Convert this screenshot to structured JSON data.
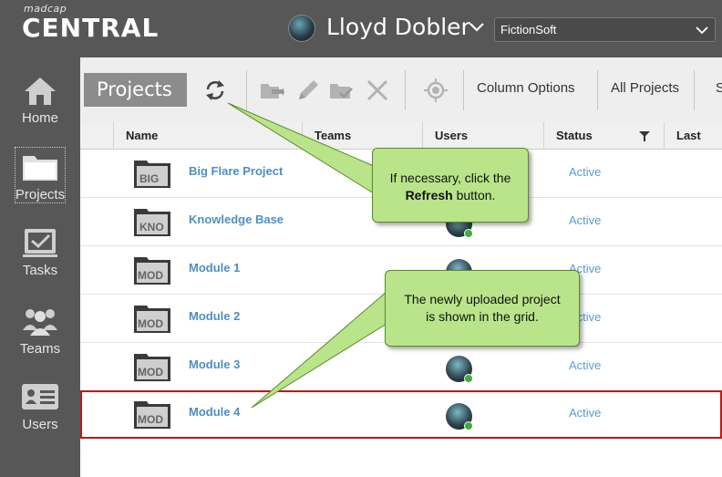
{
  "header": {
    "brand_small": "madcap",
    "brand_big": "CENTRAL",
    "user_name": "Lloyd Dobler",
    "org_selected": "FictionSoft"
  },
  "sidebar": {
    "items": [
      {
        "label": "Home",
        "icon": "home-icon"
      },
      {
        "label": "Projects",
        "icon": "folder-icon"
      },
      {
        "label": "Tasks",
        "icon": "checkbox-icon"
      },
      {
        "label": "Teams",
        "icon": "team-icon"
      },
      {
        "label": "Users",
        "icon": "id-card-icon"
      }
    ],
    "active": "Projects"
  },
  "toolbar": {
    "title": "Projects",
    "column_options": "Column Options",
    "all_projects": "All Projects",
    "truncated": "S"
  },
  "grid": {
    "columns": [
      "Name",
      "Teams",
      "Users",
      "Status",
      "Last Buil"
    ],
    "rows": [
      {
        "tag": "BIG",
        "name": "Big Flare Project",
        "has_user": false,
        "status": "Active"
      },
      {
        "tag": "KNO",
        "name": "Knowledge Base",
        "has_user": true,
        "status": "Active"
      },
      {
        "tag": "MOD",
        "name": "Module 1",
        "has_user": true,
        "status": "Active"
      },
      {
        "tag": "MOD",
        "name": "Module 2",
        "has_user": false,
        "status": "Active"
      },
      {
        "tag": "MOD",
        "name": "Module 3",
        "has_user": true,
        "status": "Active"
      },
      {
        "tag": "MOD",
        "name": "Module 4",
        "has_user": true,
        "status": "Active",
        "selected": true
      }
    ]
  },
  "callouts": {
    "refresh_pre": "If necessary, click the",
    "refresh_bold": "Refresh",
    "refresh_post": "button.",
    "upload": "The newly uploaded project is shown in the grid."
  },
  "colors": {
    "chrome": "#575757",
    "link": "#4d8fc4",
    "status": "#5d9ccf",
    "callout": "#b9e48a",
    "selection": "#b41c1c"
  }
}
